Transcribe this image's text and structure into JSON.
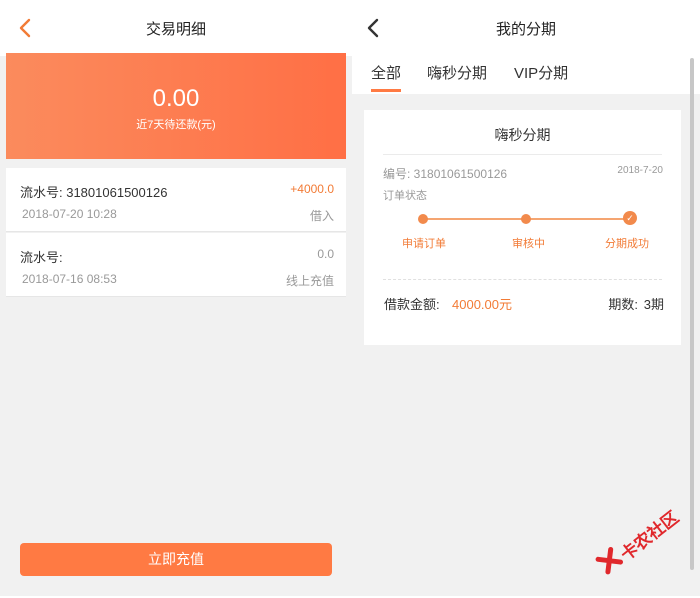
{
  "left": {
    "header": {
      "title": "交易明细"
    },
    "summary": {
      "amount": "0.00",
      "label": "近7天待还款(元)"
    },
    "records": [
      {
        "serial": "流水号: 31801061500126",
        "date": "2018-07-20 10:28",
        "amount": "+4000.0",
        "type": "借入"
      },
      {
        "serial": "流水号:",
        "date": "2018-07-16 08:53",
        "amount": "0.0",
        "type": "线上充值"
      }
    ],
    "action_button": "立即充值"
  },
  "right": {
    "header": {
      "title": "我的分期"
    },
    "tabs": [
      {
        "label": "全部",
        "active": true
      },
      {
        "label": "嗨秒分期",
        "active": false
      },
      {
        "label": "VIP分期",
        "active": false
      }
    ],
    "card": {
      "title": "嗨秒分期",
      "order_no": "编号: 31801061500126",
      "order_date": "2018-7-20",
      "status_label": "订单状态",
      "steps": [
        "申请订单",
        "审核中",
        "分期成功"
      ],
      "loan_label": "借款金额:",
      "loan_amount": "4000.00元",
      "period_label": "期数:",
      "period_value": "3期"
    }
  },
  "watermark": {
    "text": "卡农社区"
  },
  "colors": {
    "accent": "#ff7a43",
    "amount_positive": "#f27b36",
    "background": "#f1f1f1"
  },
  "icons": {
    "back": "chevron-left-icon",
    "step_done": "check-icon",
    "logo": "kanong-logo"
  }
}
